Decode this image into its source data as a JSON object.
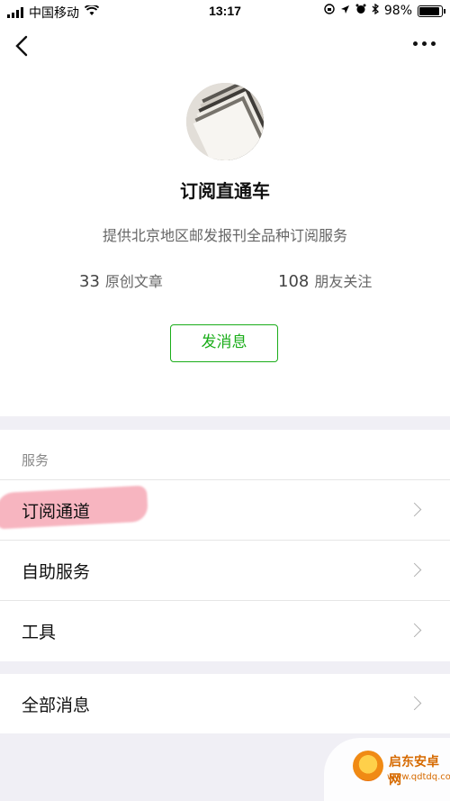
{
  "status_bar": {
    "carrier": "中国移动",
    "time": "13:17",
    "battery": "98%",
    "battery_level": 0.98
  },
  "profile": {
    "name": "订阅直通车",
    "description": "提供北京地区邮发报刊全品种订阅服务",
    "stats": [
      {
        "count": "33",
        "label": "原创文章"
      },
      {
        "count": "108",
        "label": "朋友关注"
      }
    ],
    "message_button": "发消息"
  },
  "services": {
    "header": "服务",
    "items": [
      {
        "label": "订阅通道",
        "highlighted": true
      },
      {
        "label": "自助服务"
      },
      {
        "label": "工具"
      }
    ]
  },
  "all_messages": {
    "label": "全部消息"
  },
  "watermark": {
    "title": "启东安卓网",
    "url": "www.qdtdq.com"
  },
  "colors": {
    "accent": "#1aad19",
    "highlight": "#f1788c",
    "background": "#f0eff5"
  }
}
